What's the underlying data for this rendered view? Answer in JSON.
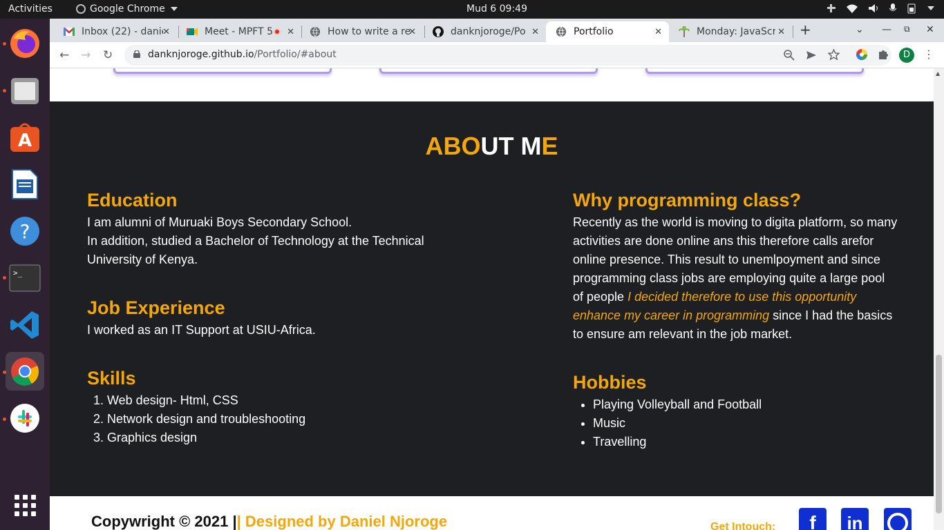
{
  "system": {
    "activities": "Activities",
    "app_name": "Google Chrome",
    "clock": "Mud 6  09:49"
  },
  "tabs": [
    {
      "label": "Inbox (22) - danie",
      "icon": "gmail-icon"
    },
    {
      "label": "Meet - MPFT 5",
      "icon": "meet-icon"
    },
    {
      "label": "How to write a re",
      "icon": "globe-icon"
    },
    {
      "label": "danknjoroge/Po",
      "icon": "github-icon"
    },
    {
      "label": "Portfolio",
      "icon": "globe-icon",
      "active": true
    },
    {
      "label": "Monday: JavaScr",
      "icon": "palm-icon"
    }
  ],
  "omnibox": {
    "host": "danknjoroge.github.io",
    "path": "/Portfolio/#about"
  },
  "profile_initial": "D",
  "about": {
    "title_parts": [
      {
        "text": "ABO",
        "color": "#f4a70a"
      },
      {
        "text": "UT M",
        "color": "#ffffff"
      },
      {
        "text": "E",
        "color": "#f4a70a"
      }
    ],
    "education": {
      "heading": "Education",
      "line1": "I am alumni of Muruaki Boys Secondary School.",
      "line2": "In addition, studied a Bachelor of Technology at the Technical University of Kenya."
    },
    "job": {
      "heading": "Job Experience",
      "text": "I worked as an IT Support at USIU-Africa."
    },
    "skills": {
      "heading": "Skills",
      "items": [
        "Web design- Html, CSS",
        "Network design and troubleshooting",
        "Graphics design"
      ]
    },
    "why": {
      "heading": "Why programming class?",
      "text_before": "Recently as the world is moving to digita platform, so many activities are done online ans this therefore calls arefor online presence. This result to unemlpoyment and since programming class jobs are employing quite a large pool of people ",
      "highlight": "I decided therefore to use this opportunity enhance my career in programming",
      "text_after": " since I had the basics to ensure am relevant in the job market."
    },
    "hobbies": {
      "heading": "Hobbies",
      "items": [
        "Playing Volleyball and Football",
        "Music",
        "Travelling"
      ]
    }
  },
  "footer": {
    "copyright": "Copywright © 2021 |",
    "designer": "| Designed by Daniel Njoroge",
    "get_intouch": "Get Intouch:",
    "social": [
      {
        "name": "facebook-icon",
        "glyph": "f"
      },
      {
        "name": "linkedin-icon",
        "glyph": "in"
      },
      {
        "name": "github-icon",
        "glyph": "gh"
      }
    ]
  },
  "colors": {
    "accent": "#f4a70a",
    "section_bg": "#1e1f22",
    "social_blue": "#0f2fd1"
  }
}
